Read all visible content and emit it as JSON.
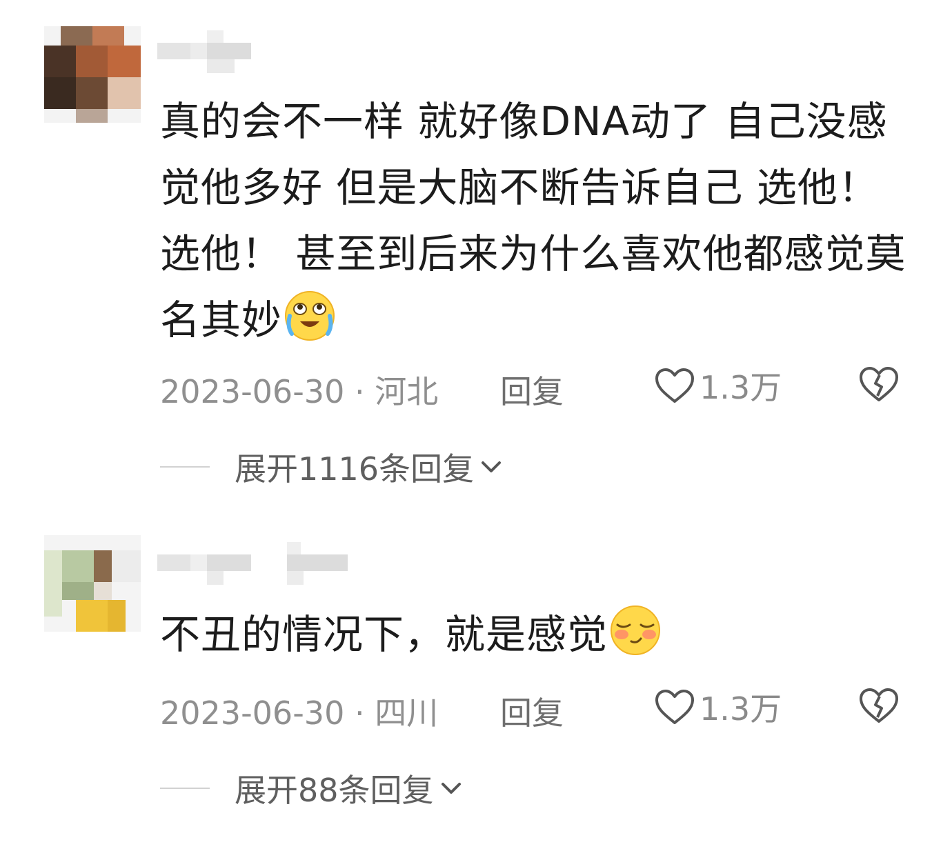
{
  "comments": [
    {
      "text": "真的会不一样 就好像DNA动了 自己没感觉他多好 但是大脑不断告诉自己 选他！选他！ 甚至到后来为什么喜欢他都感觉莫名其妙",
      "emoji": "crying-laughing-emoji",
      "date_location": "2023-06-30 · 河北",
      "reply_label": "回复",
      "like_count": "1.3万",
      "expand_label": "展开1116条回复"
    },
    {
      "text": "不丑的情况下，就是感觉",
      "emoji": "shy-blushing-emoji",
      "date_location": "2023-06-30 · 四川",
      "reply_label": "回复",
      "like_count": "1.3万",
      "expand_label": "展开88条回复"
    }
  ],
  "colors": {
    "text": "#1c1c1c",
    "meta": "#8f8f8f",
    "icon_stroke": "#555555",
    "divider": "#d2d2d2"
  }
}
